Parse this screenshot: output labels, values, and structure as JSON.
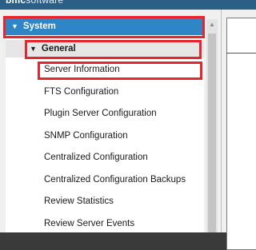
{
  "header": {
    "logo_text": "bmc",
    "logo_rest": "software"
  },
  "nav": {
    "section": {
      "label": "System",
      "arrow": "▼"
    },
    "subsection": {
      "label": "General",
      "arrow": "▼"
    },
    "items": [
      "Server Information",
      "FTS Configuration",
      "Plugin Server Configuration",
      "SNMP Configuration",
      "Centralized Configuration",
      "Centralized Configuration Backups",
      "Review Statistics",
      "Review Server Events"
    ]
  },
  "scroll": {
    "up_glyph": "▲"
  },
  "colors": {
    "section_bg": "#2f86c7",
    "highlight": "#e8242c"
  }
}
